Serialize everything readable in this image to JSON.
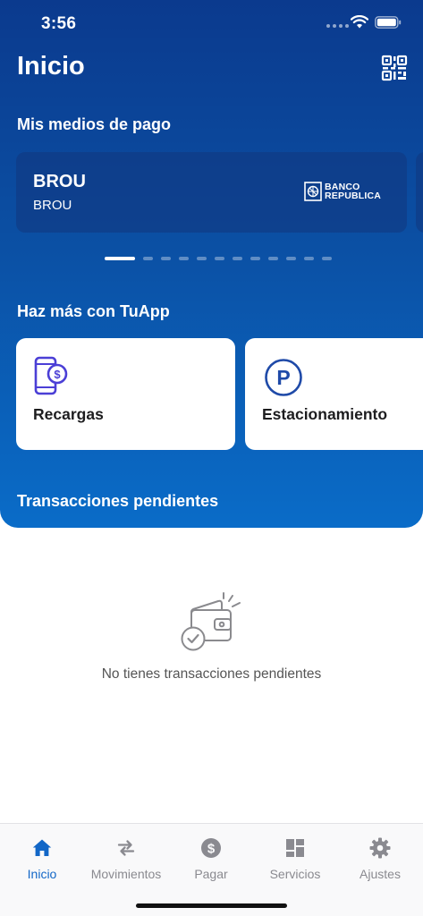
{
  "status_bar": {
    "time": "3:56"
  },
  "header": {
    "title": "Inicio",
    "qr_icon": "qr-code-icon"
  },
  "payment_methods": {
    "section_title": "Mis medios de pago",
    "cards": [
      {
        "name": "BROU",
        "subtitle": "BROU",
        "logo_line1": "BANCO",
        "logo_line2": "REPUBLICA"
      }
    ],
    "page_count": 12,
    "active_page": 1
  },
  "features": {
    "section_title": "Haz más con TuApp",
    "items": [
      {
        "label": "Recargas",
        "icon": "phone-recharge-icon"
      },
      {
        "label": "Estacionamiento",
        "icon": "parking-icon"
      }
    ]
  },
  "pending": {
    "section_title": "Transacciones pendientes",
    "empty_text": "No tienes transacciones pendientes",
    "empty_icon": "wallet-check-icon"
  },
  "tab_bar": {
    "items": [
      {
        "label": "Inicio",
        "icon": "home-icon",
        "active": true
      },
      {
        "label": "Movimientos",
        "icon": "transfer-arrows-icon",
        "active": false
      },
      {
        "label": "Pagar",
        "icon": "dollar-coin-icon",
        "active": false
      },
      {
        "label": "Servicios",
        "icon": "grid-icon",
        "active": false
      },
      {
        "label": "Ajustes",
        "icon": "gear-icon",
        "active": false
      }
    ]
  },
  "colors": {
    "accent": "#1267c7",
    "hero_top": "#0b3a8e",
    "hero_bottom": "#0a6cc8",
    "icon_indigo": "#4b3fd6"
  }
}
